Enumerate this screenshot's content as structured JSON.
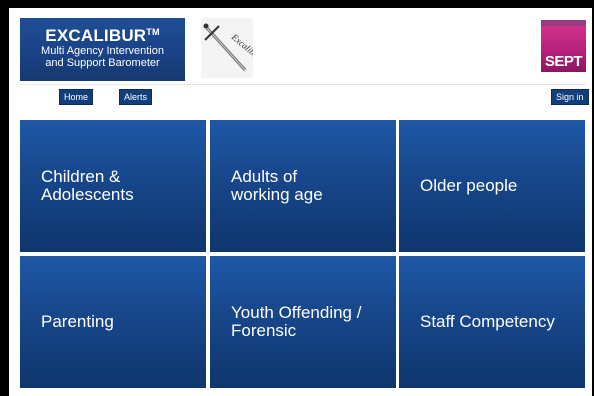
{
  "branding": {
    "title": "EXCALIBUR",
    "trademark": "TM",
    "subtitle_line1": "Multi Agency Intervention",
    "subtitle_line2": "and Support Barometer",
    "sword_logo_text": "Excalibur",
    "partner_logo_text": "SEPT",
    "partner_color": "#c0277f",
    "brand_color": "#1a4286"
  },
  "nav": {
    "home": "Home",
    "alerts": "Alerts",
    "sign_in": "Sign in"
  },
  "tiles": [
    {
      "label": "Children &\nAdolescents"
    },
    {
      "label": "Adults of\nworking age"
    },
    {
      "label": "Older people"
    },
    {
      "label": "Parenting"
    },
    {
      "label": "Youth Offending /\nForensic"
    },
    {
      "label": "Staff Competency"
    }
  ]
}
